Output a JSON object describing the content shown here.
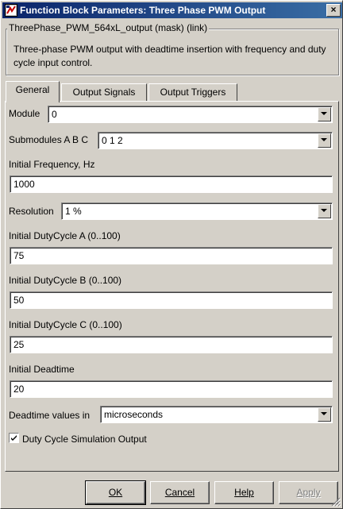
{
  "window": {
    "title": "Function Block Parameters: Three Phase PWM Output",
    "close_glyph": "×"
  },
  "mask": {
    "legend": "ThreePhase_PWM_564xL_output (mask) (link)",
    "description": "Three-phase PWM output with deadtime insertion with frequency and duty cycle input control."
  },
  "tabs": [
    {
      "label": "General",
      "active": true
    },
    {
      "label": "Output Signals",
      "active": false
    },
    {
      "label": "Output Triggers",
      "active": false
    }
  ],
  "general": {
    "module": {
      "label": "Module",
      "value": "0"
    },
    "submodules": {
      "label": "Submodules A B C",
      "value": "0 1 2"
    },
    "initial_frequency": {
      "label": "Initial Frequency, Hz",
      "value": "1000"
    },
    "resolution": {
      "label": "Resolution",
      "value": "1 %"
    },
    "duty_a": {
      "label": "Initial DutyCycle A (0..100)",
      "value": "75"
    },
    "duty_b": {
      "label": "Initial DutyCycle B (0..100)",
      "value": "50"
    },
    "duty_c": {
      "label": "Initial DutyCycle C (0..100)",
      "value": "25"
    },
    "deadtime": {
      "label": "Initial Deadtime",
      "value": "20"
    },
    "deadtime_units": {
      "label": "Deadtime values in",
      "value": "microseconds"
    },
    "duty_sim_output": {
      "label": "Duty Cycle Simulation Output",
      "checked": true
    }
  },
  "buttons": {
    "ok": "OK",
    "cancel": "Cancel",
    "help": "Help",
    "apply": "Apply"
  },
  "colors": {
    "title_start": "#0a246a",
    "title_end": "#3a6ea5",
    "face": "#d4d0c8"
  }
}
